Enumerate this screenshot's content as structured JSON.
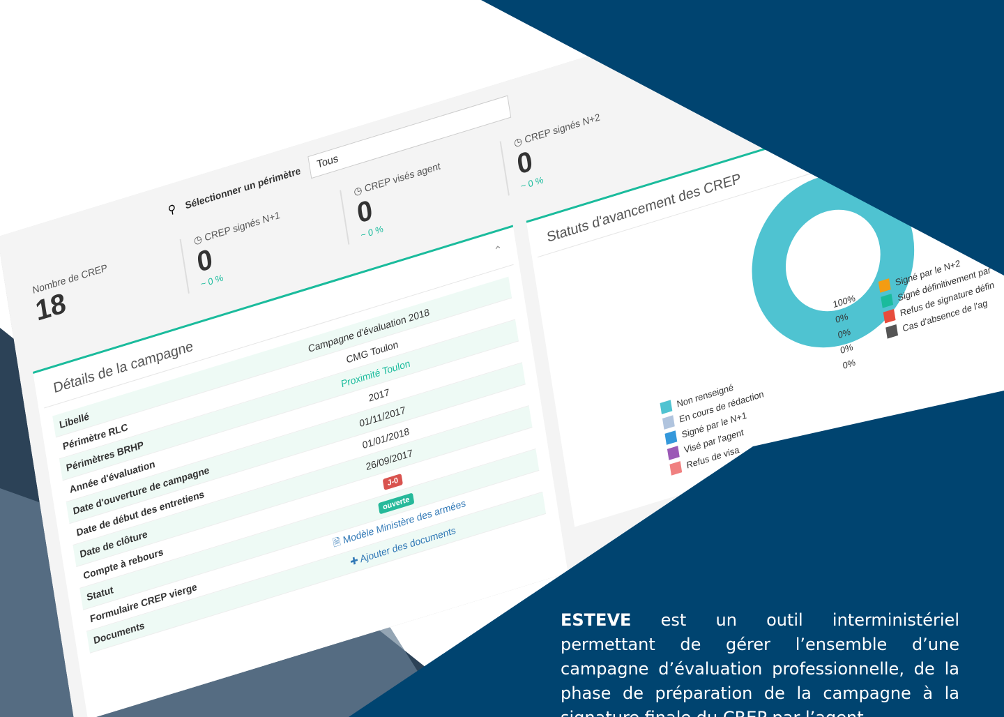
{
  "filter": {
    "label": "Sélectionner un périmètre",
    "value": "Tous"
  },
  "kpis": [
    {
      "label": "Nombre de CREP",
      "value": "18",
      "delta": ""
    },
    {
      "label": "CREP signés N+1",
      "value": "0",
      "delta": "~ 0 %"
    },
    {
      "label": "CREP visés agent",
      "value": "0",
      "delta": "~ 0 %"
    },
    {
      "label": "CREP signés N+2",
      "value": "0",
      "delta": "~ 0 %"
    }
  ],
  "campaign": {
    "title": "Détails de la campagne",
    "rows": [
      {
        "key": "Libellé",
        "value": "Campagne d'évaluation 2018"
      },
      {
        "key": "Périmètre RLC",
        "value": "CMG Toulon"
      },
      {
        "key": "Périmètres BRHP",
        "value": "Proximité Toulon"
      },
      {
        "key": "Année d'évaluation",
        "value": "2017"
      },
      {
        "key": "Date d'ouverture de campagne",
        "value": "01/11/2017"
      },
      {
        "key": "Date de début des entretiens",
        "value": "01/01/2018"
      },
      {
        "key": "Date de clôture",
        "value": "26/09/2017"
      },
      {
        "key": "Compte à rebours",
        "value": "J-0"
      },
      {
        "key": "Statut",
        "value": "ouverte"
      },
      {
        "key": "Formulaire CREP vierge",
        "value": "Modèle Ministère des armées"
      },
      {
        "key": "Documents",
        "value": "Ajouter des documents"
      }
    ]
  },
  "status_panel": {
    "title": "Statuts d'avancement des CREP",
    "legend_left": [
      {
        "label": "Non renseigné",
        "color": "#4fc3d1"
      },
      {
        "label": "En cours de rédaction",
        "color": "#b0c4de"
      },
      {
        "label": "Signé par le N+1",
        "color": "#3498db"
      },
      {
        "label": "Visé par l'agent",
        "color": "#9b59b6"
      },
      {
        "label": "Refus de visa",
        "color": "#f08080"
      }
    ],
    "percentages": [
      "100%",
      "0%",
      "0%",
      "0%",
      "0%"
    ],
    "legend_right": [
      {
        "label": "Signé par le N+2",
        "color": "#f39c12"
      },
      {
        "label": "Signé définitivement par",
        "color": "#1abb9c"
      },
      {
        "label": "Refus de signature défin",
        "color": "#e74c3c"
      },
      {
        "label": "Cas d'absence de l'ag",
        "color": "#555555"
      }
    ]
  },
  "description": {
    "brand": "ESTEVE",
    "text": " est un outil interministériel permettant de gérer l’ensemble d’une campagne d’évaluation professionnelle, de la phase de préparation de la campagne à la signature finale du CREP par l’agent."
  }
}
